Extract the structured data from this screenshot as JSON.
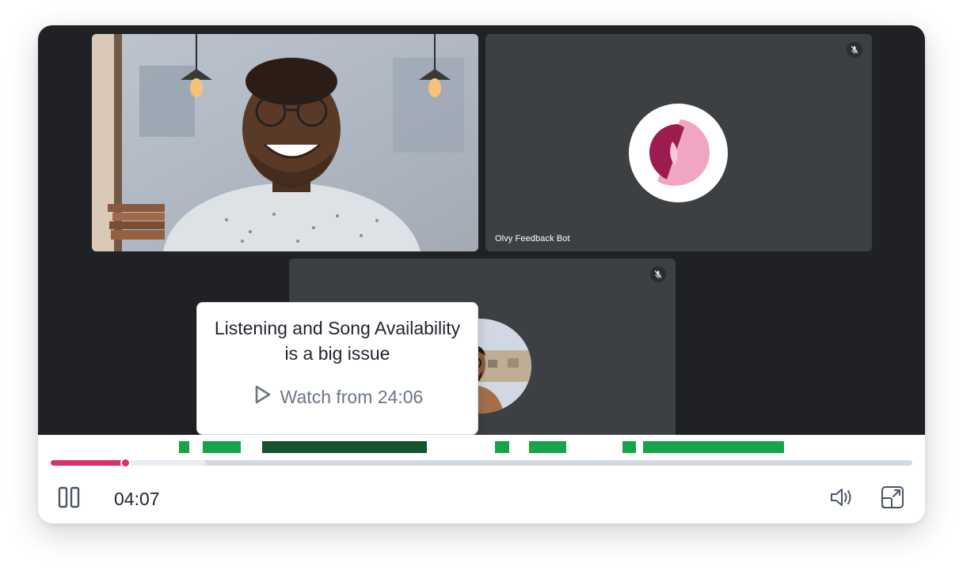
{
  "participants": [
    {
      "id": "speaker",
      "name": "",
      "muted": false
    },
    {
      "id": "bot",
      "name": "Olvy Feedback Bot",
      "muted": true
    },
    {
      "id": "guest",
      "name": "",
      "muted": true
    }
  ],
  "tooltip": {
    "title": "Listening and Song Availability is a big issue",
    "watch_label": "Watch from 24:06"
  },
  "playback": {
    "current_time": "04:07",
    "played_fraction": 0.086,
    "buffered_fraction": 0.18
  },
  "feedback_segments": [
    {
      "start_fraction": 0.159,
      "end_fraction": 0.171,
      "active": false
    },
    {
      "start_fraction": 0.186,
      "end_fraction": 0.229,
      "active": false
    },
    {
      "start_fraction": 0.253,
      "end_fraction": 0.439,
      "active": true
    },
    {
      "start_fraction": 0.515,
      "end_fraction": 0.531,
      "active": false
    },
    {
      "start_fraction": 0.554,
      "end_fraction": 0.596,
      "active": false
    },
    {
      "start_fraction": 0.659,
      "end_fraction": 0.674,
      "active": false
    },
    {
      "start_fraction": 0.682,
      "end_fraction": 0.841,
      "active": false
    }
  ],
  "colors": {
    "progress": "#d6336c",
    "segment": "#16a34a",
    "segment_active": "#14532d",
    "stage": "#202124",
    "tile": "#3c4043",
    "logo_dark": "#9d1c4f",
    "logo_light": "#f0a6c3"
  },
  "icons": {
    "pause": "pause-icon",
    "volume": "volume-icon",
    "fullscreen": "fullscreen-icon",
    "play": "play-outline-icon",
    "mic_off": "mic-off-icon"
  }
}
